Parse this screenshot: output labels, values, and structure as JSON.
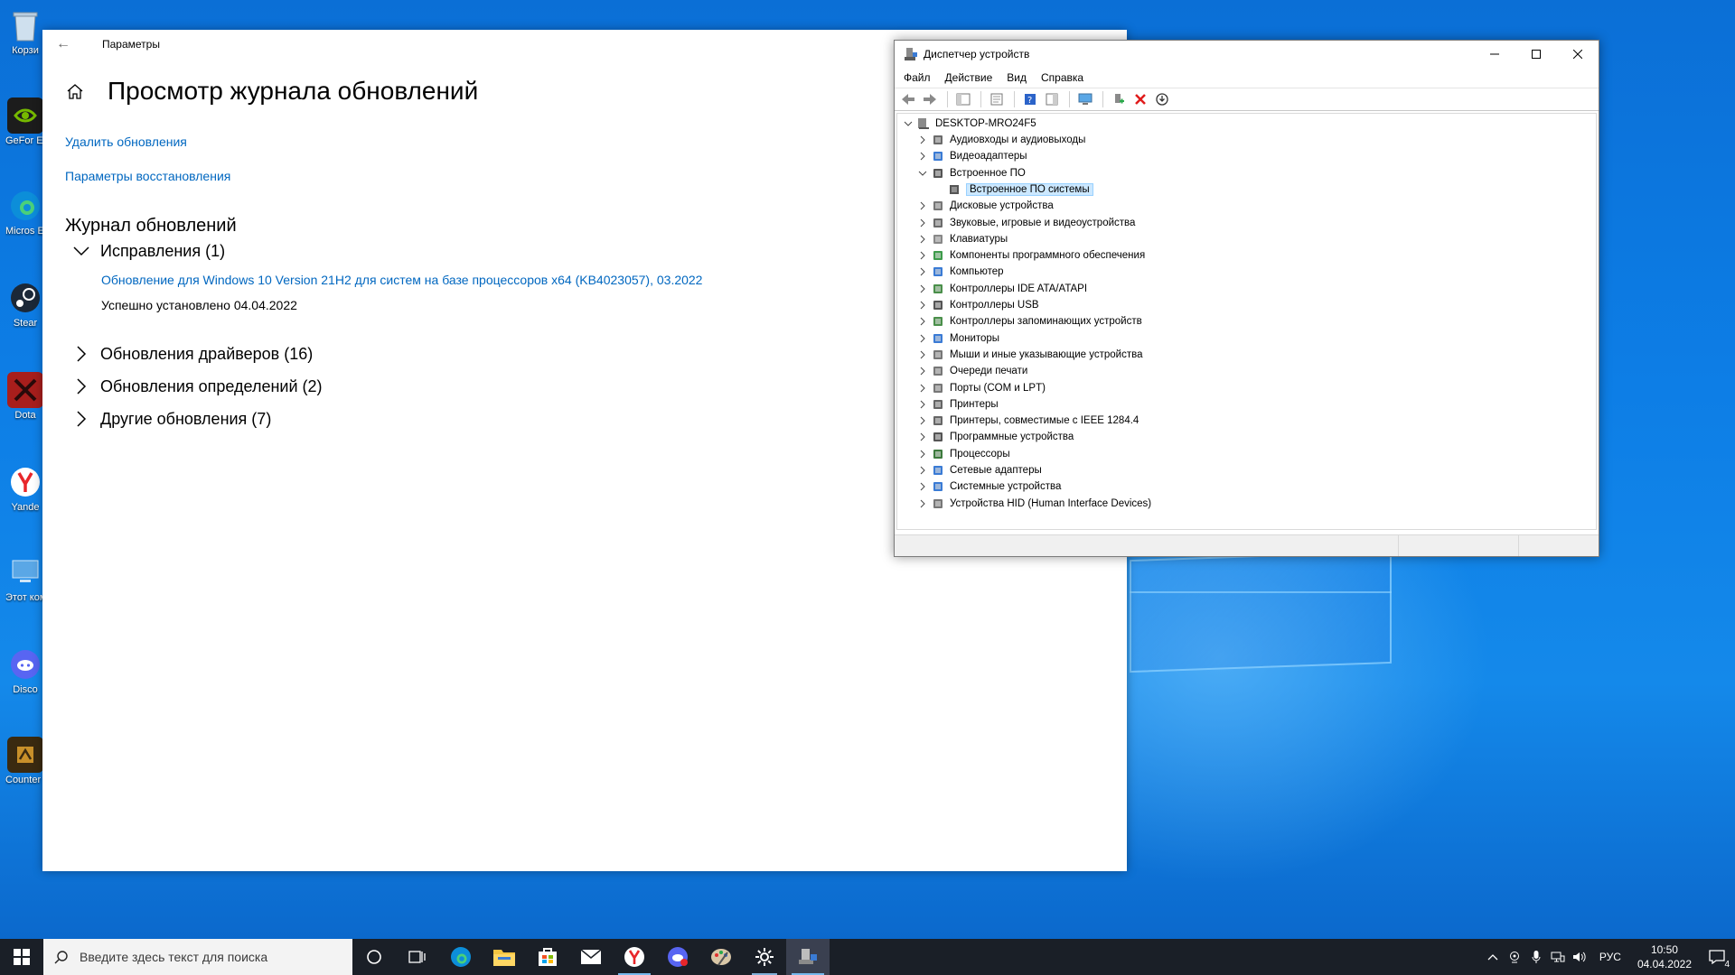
{
  "desktop": {
    "icons": [
      {
        "label": "Корзи",
        "color": "#9fb4c8"
      },
      {
        "label": "GeFor Experi",
        "color": "#2b2b2b"
      },
      {
        "label": "Micros Edge",
        "color": "#0e8fd6"
      },
      {
        "label": "Stear",
        "color": "#1b2838"
      },
      {
        "label": "Dota",
        "color": "#b0201e"
      },
      {
        "label": "Yande",
        "color": "#ffffff"
      },
      {
        "label": "Этот компь",
        "color": "#5aa7e6"
      },
      {
        "label": "Disco",
        "color": "#5865f2"
      },
      {
        "label": "Counter Global C",
        "color": "#c8902a"
      }
    ]
  },
  "settings": {
    "app_title": "Параметры",
    "page_title": "Просмотр журнала обновлений",
    "links": {
      "uninstall": "Удалить обновления",
      "recovery": "Параметры восстановления"
    },
    "section_title": "Журнал обновлений",
    "groups": [
      {
        "label": "Исправления (1)",
        "expanded": true
      },
      {
        "label": "Обновления драйверов (16)",
        "expanded": false
      },
      {
        "label": "Обновления определений (2)",
        "expanded": false
      },
      {
        "label": "Другие обновления (7)",
        "expanded": false
      }
    ],
    "update_item": {
      "title": "Обновление для Windows 10 Version 21H2 для систем на базе процессоров x64 (KB4023057), 03.2022",
      "status": "Успешно установлено 04.04.2022"
    }
  },
  "devmgr": {
    "title": "Диспетчер устройств",
    "menu": [
      "Файл",
      "Действие",
      "Вид",
      "Справка"
    ],
    "computer": "DESKTOP-MRO24F5",
    "categories": [
      "Аудиовходы и аудиовыходы",
      "Видеоадаптеры",
      "Встроенное ПО",
      "Дисковые устройства",
      "Звуковые, игровые и видеоустройства",
      "Клавиатуры",
      "Компоненты программного обеспечения",
      "Компьютер",
      "Контроллеры IDE ATA/ATAPI",
      "Контроллеры USB",
      "Контроллеры запоминающих устройств",
      "Мониторы",
      "Мыши и иные указывающие устройства",
      "Очереди печати",
      "Порты (COM и LPT)",
      "Принтеры",
      "Принтеры, совместимые с IEEE 1284.4",
      "Программные устройства",
      "Процессоры",
      "Сетевые адаптеры",
      "Системные устройства",
      "Устройства HID (Human Interface Devices)"
    ],
    "firmware_child": "Встроенное ПО системы"
  },
  "taskbar": {
    "search_placeholder": "Введите здесь текст для поиска",
    "lang": "РУС",
    "time": "10:50",
    "date": "04.04.2022",
    "notification_count": "4",
    "accent": "#76b9ed"
  }
}
